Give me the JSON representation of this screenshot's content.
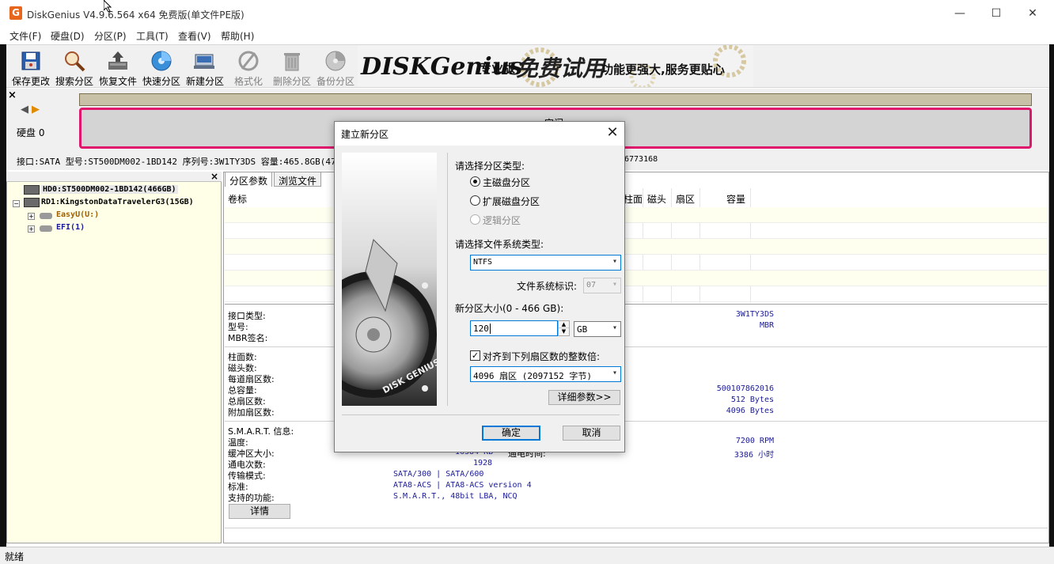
{
  "window": {
    "title": "DiskGenius V4.9.6.564 x64 免费版(单文件PE版)",
    "minimize": "—",
    "maximize": "☐",
    "close": "✕"
  },
  "menu": [
    "文件(F)",
    "硬盘(D)",
    "分区(P)",
    "工具(T)",
    "查看(V)",
    "帮助(H)"
  ],
  "toolbar": [
    {
      "label": "保存更改",
      "icon": "save-icon",
      "enabled": true
    },
    {
      "label": "搜索分区",
      "icon": "search-icon",
      "enabled": true
    },
    {
      "label": "恢复文件",
      "icon": "recover-icon",
      "enabled": true
    },
    {
      "label": "快速分区",
      "icon": "quick-partition-icon",
      "enabled": true
    },
    {
      "label": "新建分区",
      "icon": "new-partition-icon",
      "enabled": true
    },
    {
      "label": "格式化",
      "icon": "format-icon",
      "enabled": false
    },
    {
      "label": "删除分区",
      "icon": "delete-icon",
      "enabled": false
    },
    {
      "label": "备份分区",
      "icon": "backup-icon",
      "enabled": false
    }
  ],
  "banner": {
    "brand": "DISKGenius",
    "edition": "专业版",
    "slogan1": "免费试用",
    "slogan2": "功能更强大,服务更贴心"
  },
  "diskmap": {
    "close": "×",
    "disk_label": "硬盘 0",
    "partition_label": "空闲",
    "info": "接口:SATA  型号:ST500DM002-1BD142  序列号:3W1TY3DS  容量:465.8GB(47",
    "info_tail": "6773168"
  },
  "tree": {
    "close": "×",
    "nodes": [
      {
        "label": "HD0:ST500DM002-1BD142(466GB)",
        "color": "#000000"
      },
      {
        "label": "RD1:KingstonDataTravelerG3(15GB)",
        "color": "#000000"
      },
      {
        "label": "EasyU(U:)",
        "color": "#a06000"
      },
      {
        "label": "EFI(1)",
        "color": "#1a1a9a"
      }
    ]
  },
  "panel": {
    "tabs": [
      "分区参数",
      "浏览文件"
    ],
    "columns": [
      "卷标",
      "柱面",
      "磁头",
      "扇区",
      "容量"
    ],
    "labels_group1": [
      "接口类型:",
      "型号:",
      "MBR签名:"
    ],
    "values_group1": [
      "3W1TY3DS",
      "MBR"
    ],
    "labels_group2": [
      "柱面数:",
      "磁头数:",
      "每道扇区数:",
      "总容量:",
      "总扇区数:",
      "附加扇区数:"
    ],
    "values_group2": [
      "500107862016",
      "512 Bytes",
      "4096 Bytes"
    ],
    "labels_group3": [
      "S.M.A.R.T. 信息:",
      "温度:",
      "缓冲区大小:",
      "通电次数:",
      "传输模式:",
      "标准:",
      "支持的功能:"
    ],
    "buffer_value": "16384 KB",
    "power_time_label": "通电时间:",
    "power_count": "1928",
    "transfer_mode": "SATA/300 | SATA/600",
    "standard": "ATA8-ACS | ATA8-ACS version 4",
    "features": "S.M.A.R.T., 48bit LBA, NCQ",
    "rpm": "7200 RPM",
    "hours": "3386 小时",
    "details_button": "详情"
  },
  "status": "就绪",
  "dialog": {
    "title": "建立新分区",
    "close": "✕",
    "image_caption": "DISK GENIUS",
    "partition_type_label": "请选择分区类型:",
    "options": [
      {
        "label": "主磁盘分区",
        "checked": true,
        "enabled": true
      },
      {
        "label": "扩展磁盘分区",
        "checked": false,
        "enabled": true
      },
      {
        "label": "逻辑分区",
        "checked": false,
        "enabled": false
      }
    ],
    "fs_type_label": "请选择文件系统类型:",
    "fs_value": "NTFS",
    "fs_id_label": "文件系统标识:",
    "fs_id_value": "07",
    "size_label": "新分区大小(0 - 466 GB):",
    "size_value": "120",
    "unit_value": "GB",
    "align_label": "对齐到下列扇区数的整数倍:",
    "align_checked": true,
    "align_value": "4096 扇区 (2097152 字节)",
    "advanced_button": "详细参数>>",
    "ok_button": "确定",
    "cancel_button": "取消"
  }
}
